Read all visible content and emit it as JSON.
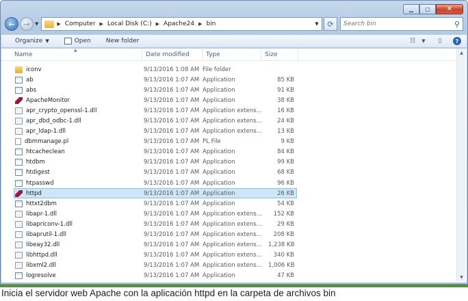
{
  "window": {
    "caption_buttons": {
      "minimize": "▁",
      "maximize": "▢",
      "close": "✕"
    }
  },
  "navigation": {
    "back_icon": "←",
    "forward_icon": "→",
    "breadcrumbs": [
      "Computer",
      "Local Disk (C:)",
      "Apache24",
      "bin"
    ],
    "search_placeholder": "Search bin"
  },
  "toolbar": {
    "organize_label": "Organize",
    "open_label": "Open",
    "new_folder_label": "New folder"
  },
  "columns": {
    "name": "Name",
    "date_modified": "Date modified",
    "type": "Type",
    "size": "Size"
  },
  "files": [
    {
      "name": "iconv",
      "date": "9/13/2016 1:08 AM",
      "type": "File folder",
      "size": "",
      "icon": "folder"
    },
    {
      "name": "ab",
      "date": "9/13/2016 1:07 AM",
      "type": "Application",
      "size": "85 KB",
      "icon": "app"
    },
    {
      "name": "abs",
      "date": "9/13/2016 1:07 AM",
      "type": "Application",
      "size": "91 KB",
      "icon": "app"
    },
    {
      "name": "ApacheMonitor",
      "date": "9/13/2016 1:07 AM",
      "type": "Application",
      "size": "38 KB",
      "icon": "feather"
    },
    {
      "name": "apr_crypto_openssl-1.dll",
      "date": "9/13/2016 1:07 AM",
      "type": "Application extens...",
      "size": "16 KB",
      "icon": "dll"
    },
    {
      "name": "apr_dbd_odbc-1.dll",
      "date": "9/13/2016 1:07 AM",
      "type": "Application extens...",
      "size": "24 KB",
      "icon": "dll"
    },
    {
      "name": "apr_ldap-1.dll",
      "date": "9/13/2016 1:07 AM",
      "type": "Application extens...",
      "size": "13 KB",
      "icon": "dll"
    },
    {
      "name": "dbmmanage.pl",
      "date": "9/13/2016 1:07 AM",
      "type": "PL File",
      "size": "9 KB",
      "icon": "doc"
    },
    {
      "name": "htcacheclean",
      "date": "9/13/2016 1:07 AM",
      "type": "Application",
      "size": "84 KB",
      "icon": "app"
    },
    {
      "name": "htdbm",
      "date": "9/13/2016 1:07 AM",
      "type": "Application",
      "size": "99 KB",
      "icon": "app"
    },
    {
      "name": "htdigest",
      "date": "9/13/2016 1:07 AM",
      "type": "Application",
      "size": "68 KB",
      "icon": "app"
    },
    {
      "name": "htpasswd",
      "date": "9/13/2016 1:07 AM",
      "type": "Application",
      "size": "96 KB",
      "icon": "app"
    },
    {
      "name": "httpd",
      "date": "9/13/2016 1:07 AM",
      "type": "Application",
      "size": "26 KB",
      "icon": "feather",
      "selected": true
    },
    {
      "name": "httxt2dbm",
      "date": "9/13/2016 1:07 AM",
      "type": "Application",
      "size": "54 KB",
      "icon": "app"
    },
    {
      "name": "libapr-1.dll",
      "date": "9/13/2016 1:07 AM",
      "type": "Application extens...",
      "size": "152 KB",
      "icon": "dll"
    },
    {
      "name": "libapriconv-1.dll",
      "date": "9/13/2016 1:07 AM",
      "type": "Application extens...",
      "size": "29 KB",
      "icon": "dll"
    },
    {
      "name": "libaprutil-1.dll",
      "date": "9/13/2016 1:07 AM",
      "type": "Application extens...",
      "size": "208 KB",
      "icon": "dll"
    },
    {
      "name": "libeay32.dll",
      "date": "9/13/2016 1:07 AM",
      "type": "Application extens...",
      "size": "1,238 KB",
      "icon": "dll"
    },
    {
      "name": "libhttpd.dll",
      "date": "9/13/2016 1:07 AM",
      "type": "Application extens...",
      "size": "340 KB",
      "icon": "dll"
    },
    {
      "name": "libxml2.dll",
      "date": "9/13/2016 1:07 AM",
      "type": "Application extens...",
      "size": "1,006 KB",
      "icon": "dll"
    },
    {
      "name": "logresolve",
      "date": "9/13/2016 1:07 AM",
      "type": "Application",
      "size": "47 KB",
      "icon": "app"
    }
  ],
  "caption": "Inicia el servidor web Apache con la aplicación httpd en la carpeta de archivos bin"
}
